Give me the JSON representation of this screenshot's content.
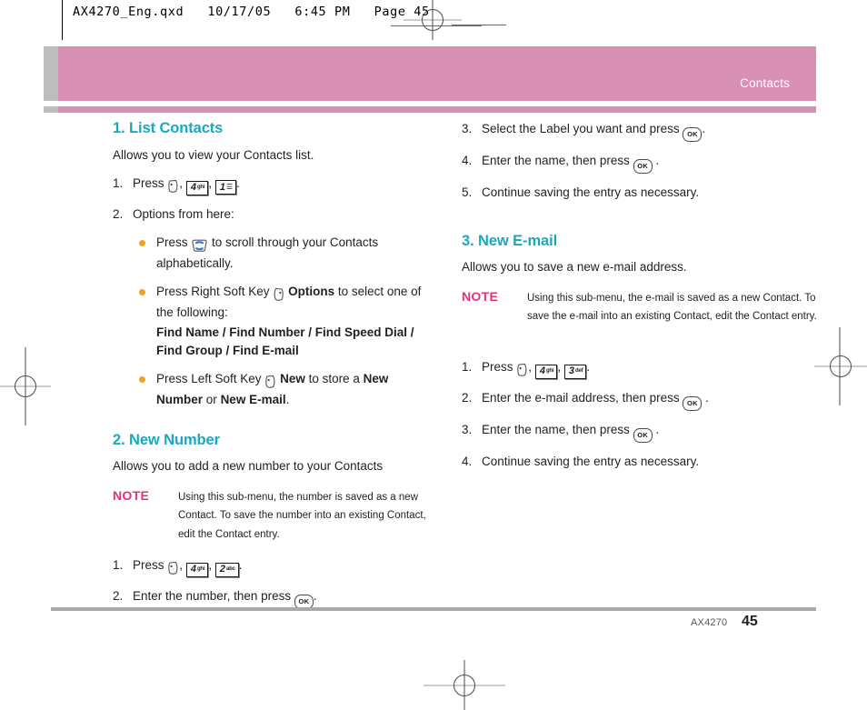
{
  "print_marks": {
    "qxd_header": "AX4270_Eng.qxd   10/17/05   6:45 PM   Page 45"
  },
  "header": {
    "title": "Contacts",
    "band_color": "#d890b4",
    "tab_color": "#bdbdbd"
  },
  "accent": {
    "heading_teal": "#17a9c3",
    "note_pink": "#e5307f",
    "bullet_orange": "#f5a01c"
  },
  "sections": {
    "list_contacts": {
      "heading": "1. List Contacts",
      "intro": "Allows you to view your Contacts list.",
      "step1_num": "1.",
      "step1_a": "Press",
      "step1_sep1": ",",
      "step1_sep2": ",",
      "step1_end": ".",
      "step2_num": "2.",
      "step2": "Options from here:",
      "bullet1_a": "Press",
      "bullet1_b": "to scroll through your Contacts alphabetically.",
      "bullet2_a": "Press Right Soft Key",
      "bullet2_b": "Options",
      "bullet2_c": "to select one of the following:",
      "bullet2_options": "Find Name / Find Number / Find Speed Dial / Find Group / Find E-mail",
      "bullet3_a": "Press Left Soft Key",
      "bullet3_b": "New",
      "bullet3_c": "to store a",
      "bullet3_d": "New Number",
      "bullet3_e": "or",
      "bullet3_f": "New E-mail",
      "bullet3_end": "."
    },
    "new_number": {
      "heading": "2. New Number",
      "intro": "Allows you to add a new number to your Contacts",
      "note_label": "NOTE",
      "note_body": "Using this sub-menu, the number is saved as a new Contact. To save the number into an existing Contact, edit the Contact entry.",
      "step1_num": "1.",
      "step1_a": "Press",
      "step1_sep1": ",",
      "step1_sep2": ",",
      "step1_end": ".",
      "step2_num": "2.",
      "step2_a": "Enter the number, then press",
      "step2_end": "."
    },
    "new_number_cont": {
      "step3_num": "3.",
      "step3_a": "Select the Label you want and press",
      "step3_end": ".",
      "step4_num": "4.",
      "step4_a": "Enter the name, then press",
      "step4_end": ".",
      "step5_num": "5.",
      "step5_a": "Continue saving the entry as necessary."
    },
    "new_email": {
      "heading": "3. New E-mail",
      "intro": "Allows you to save a new e-mail address.",
      "note_label": "NOTE",
      "note_body": "Using this sub-menu, the e-mail is saved as a new Contact. To save the e-mail into an existing Contact, edit the Contact entry.",
      "step1_num": "1.",
      "step1_a": "Press",
      "step1_sep1": ",",
      "step1_sep2": ",",
      "step1_end": ".",
      "step2_num": "2.",
      "step2_a": "Enter the e-mail address, then press",
      "step2_end": ".",
      "step3_num": "3.",
      "step3_a": "Enter the name, then press",
      "step3_end": ".",
      "step4_num": "4.",
      "step4_a": "Continue saving the entry as necessary."
    }
  },
  "keys": {
    "left_soft": "left-soft-key",
    "right_soft": "right-soft-key",
    "nav": "navigation-key",
    "ok": "OK",
    "k1_digit": "1",
    "k1_sym": "☰",
    "k2_digit": "2",
    "k2_abc": "abc",
    "k3_digit": "3",
    "k3_abc": "def",
    "k4_digit": "4",
    "k4_abc": "ghi"
  },
  "footer": {
    "model": "AX4270",
    "page": "45"
  }
}
